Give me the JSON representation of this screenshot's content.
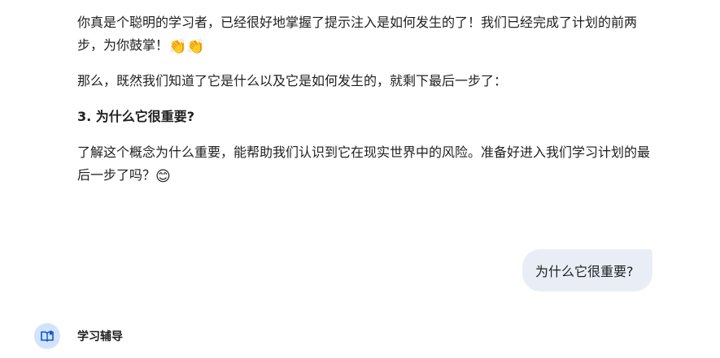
{
  "response": {
    "p1_text": "你真是个聪明的学习者，已经很好地掌握了提示注入是如何发生的了！我们已经完成了计划的前两步，为你鼓掌！",
    "p1_emoji": "👏👏",
    "p2_text": "那么，既然我们知道了它是什么以及它是如何发生的，就剩下最后一步了：",
    "p3_text": "3. 为什么它很重要?",
    "p4_text": "了解这个概念为什么重要，能帮助我们认识到它在现实世界中的风险。准备好进入我们学习计划的最后一步了吗？",
    "p4_emoji": "😊"
  },
  "user_message": {
    "text": "为什么它很重要?"
  },
  "assistant": {
    "name": "学习辅导",
    "avatar_icon": "book-icon",
    "avatar_color": "#d3e3fd",
    "icon_color": "#0b57d0"
  },
  "colors": {
    "user_bubble": "#e9eef6",
    "text": "#1f1f1f"
  }
}
